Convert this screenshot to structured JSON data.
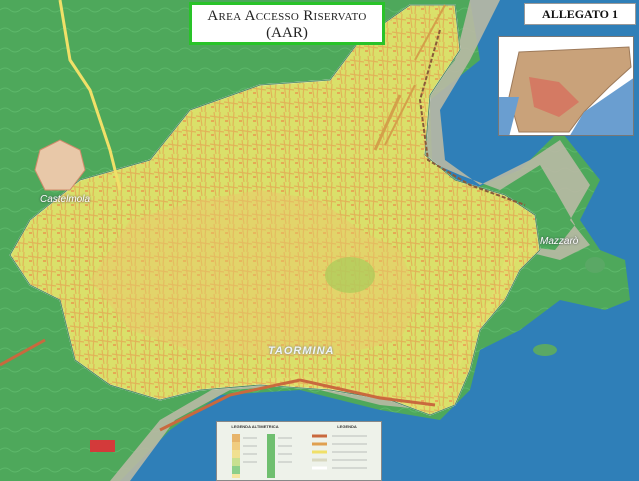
{
  "title": {
    "line1": "Area Accesso Riservato",
    "line2": "(AAR)"
  },
  "allegato": "ALLEGATO 1",
  "places": {
    "taormina": "TAORMINA",
    "castelmola": "Castelmola",
    "mazzaro": "Mazzarò"
  },
  "legend": {
    "altimetry_title": "LEGENDA ALTIMETRICA",
    "roads_title": "LEGENDA"
  },
  "colors": {
    "sea": "#2f7fb8",
    "restricted_area": "#e3e36a",
    "terrain": "#4ea85b",
    "title_border": "#29c329"
  }
}
